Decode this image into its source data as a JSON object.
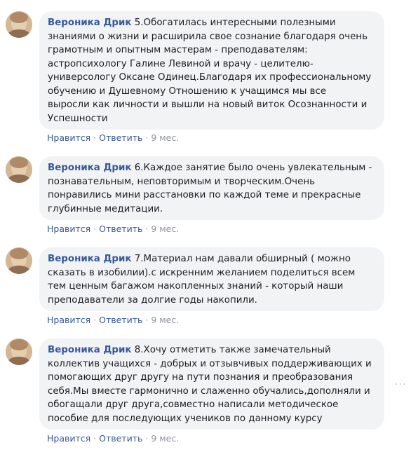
{
  "comments": [
    {
      "author": "Вероника Дрик",
      "lines": [
        "5.Обогатилась интересными полезными",
        "знаниями о жизни и расширила свое сознание благодаря очень",
        "грамотным и опытным мастерам - преподавателям:",
        "астропсихологу Галине Левиной и врачу - целителю-",
        "универсологу Оксане Одинец.Благодаря их профессиональному",
        "обучению и Душевному Отношению к учащимся мы все",
        "выросли как личности и вышли на новый виток Осознанности и",
        "Успешности"
      ],
      "like": "Нравится",
      "reply": "Ответить",
      "time": "9 мес."
    },
    {
      "author": "Вероника Дрик",
      "lines": [
        "6.Каждое занятие было очень увлекательным -",
        "познавательным, неповторимым и творческим.Очень",
        "понравились мини расстановки по каждой теме и прекрасные",
        "глубинные медитации."
      ],
      "like": "Нравится",
      "reply": "Ответить",
      "time": "9 мес."
    },
    {
      "author": "Вероника Дрик",
      "lines": [
        "7.Материал нам давали обширный ( можно",
        "сказать в изобилии).с искренним желанием поделиться всем",
        "тем ценным багажом накопленных знаний - который наши",
        "преподаватели за долгие годы накопили."
      ],
      "like": "Нравится",
      "reply": "Ответить",
      "time": "9 мес."
    },
    {
      "author": "Вероника Дрик",
      "lines": [
        "8.Хочу отметить также замечательный",
        "коллектив учащихся - добрых и отзывчивых поддерживающих и",
        "помогающих друг другу на пути познания и преобразования",
        "себя.Мы вместе гармонично и слаженно обучались,дополняли и",
        "обогащали друг друга,совместно написали методическое",
        "пособие для последующих учеников по данному курсу"
      ],
      "like": "Нравится",
      "reply": "Ответить",
      "time": "9 мес."
    }
  ],
  "separator": "·",
  "more_menu": "···"
}
